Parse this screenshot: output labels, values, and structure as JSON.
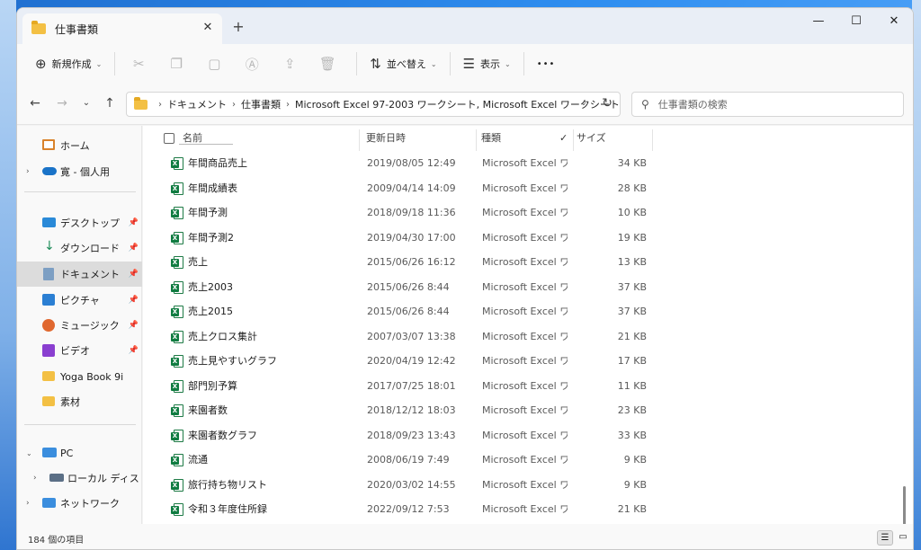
{
  "tab": {
    "title": "仕事書類",
    "close": "✕",
    "new_tab": "+"
  },
  "window_controls": {
    "minimize": "—",
    "maximize": "☐",
    "close": "✕"
  },
  "toolbar": {
    "new_label": "新規作成",
    "sort_label": "並べ替え",
    "view_label": "表示",
    "more": "•••"
  },
  "address": {
    "crumbs": [
      "ドキュメント",
      "仕事書類",
      "Microsoft Excel 97-2003 ワークシート, Microsoft Excel ワークシート"
    ],
    "search_placeholder": "仕事書類の検索"
  },
  "sidebar": {
    "items": [
      {
        "label": "ホーム"
      },
      {
        "label": "寛 - 個人用"
      },
      {
        "label": "デスクトップ"
      },
      {
        "label": "ダウンロード"
      },
      {
        "label": "ドキュメント"
      },
      {
        "label": "ピクチャ"
      },
      {
        "label": "ミュージック"
      },
      {
        "label": "ビデオ"
      },
      {
        "label": "Yoga Book 9i"
      },
      {
        "label": "素材"
      },
      {
        "label": "PC"
      },
      {
        "label": "ローカル ディスク (C:)"
      },
      {
        "label": "ネットワーク"
      }
    ]
  },
  "columns": {
    "name": "名前",
    "date": "更新日時",
    "type": "種類",
    "size": "サイズ"
  },
  "files": [
    {
      "name": "年間商品売上",
      "date": "2019/08/05 12:49",
      "type": "Microsoft Excel ワ...",
      "size": "34 KB"
    },
    {
      "name": "年間成績表",
      "date": "2009/04/14 14:09",
      "type": "Microsoft Excel ワ...",
      "size": "28 KB"
    },
    {
      "name": "年間予測",
      "date": "2018/09/18 11:36",
      "type": "Microsoft Excel ワ...",
      "size": "10 KB"
    },
    {
      "name": "年間予測2",
      "date": "2019/04/30 17:00",
      "type": "Microsoft Excel ワ...",
      "size": "19 KB"
    },
    {
      "name": "売上",
      "date": "2015/06/26 16:12",
      "type": "Microsoft Excel ワ...",
      "size": "13 KB"
    },
    {
      "name": "売上2003",
      "date": "2015/06/26 8:44",
      "type": "Microsoft Excel ワ...",
      "size": "37 KB"
    },
    {
      "name": "売上2015",
      "date": "2015/06/26 8:44",
      "type": "Microsoft Excel ワ...",
      "size": "37 KB"
    },
    {
      "name": "売上クロス集計",
      "date": "2007/03/07 13:38",
      "type": "Microsoft Excel ワ...",
      "size": "21 KB"
    },
    {
      "name": "売上見やすいグラフ",
      "date": "2020/04/19 12:42",
      "type": "Microsoft Excel ワ...",
      "size": "17 KB"
    },
    {
      "name": "部門別予算",
      "date": "2017/07/25 18:01",
      "type": "Microsoft Excel ワ...",
      "size": "11 KB"
    },
    {
      "name": "来園者数",
      "date": "2018/12/12 18:03",
      "type": "Microsoft Excel ワ...",
      "size": "23 KB"
    },
    {
      "name": "来園者数グラフ",
      "date": "2018/09/23 13:43",
      "type": "Microsoft Excel ワ...",
      "size": "33 KB"
    },
    {
      "name": "流通",
      "date": "2008/06/19 7:49",
      "type": "Microsoft Excel ワ...",
      "size": "9 KB"
    },
    {
      "name": "旅行持ち物リスト",
      "date": "2020/03/02 14:55",
      "type": "Microsoft Excel ワ...",
      "size": "9 KB"
    },
    {
      "name": "令和３年度住所録",
      "date": "2022/09/12 7:53",
      "type": "Microsoft Excel ワ...",
      "size": "21 KB"
    }
  ],
  "status": {
    "count": "184 個の項目"
  },
  "colors": {
    "excel_green": "#107c41",
    "folder_yellow": "#f3c044",
    "selected_bg": "#dcdcdc"
  }
}
